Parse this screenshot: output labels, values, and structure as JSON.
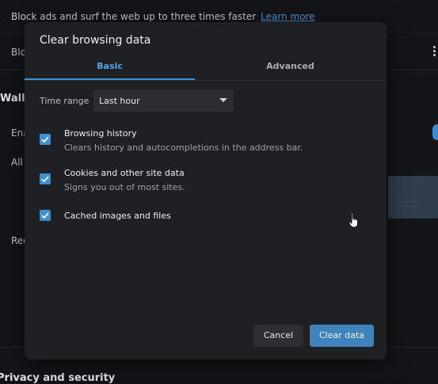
{
  "background": {
    "adblock_text": "Block ads and surf the web up to three times faster",
    "learn_more": "Learn more",
    "row2_prefix": "Blo",
    "section_prefix": "Wallp",
    "enable_prefix": "Ena",
    "all_prefix": "All",
    "rec_prefix": "Rec",
    "privacy_heading": "Privacy and security"
  },
  "dialog": {
    "title": "Clear browsing data",
    "tabs": [
      {
        "label": "Basic",
        "selected": true
      },
      {
        "label": "Advanced",
        "selected": false
      }
    ],
    "time_range": {
      "label": "Time range",
      "value": "Last hour"
    },
    "options": [
      {
        "title": "Browsing history",
        "description": "Clears history and autocompletions in the address bar.",
        "checked": true
      },
      {
        "title": "Cookies and other site data",
        "description": "Signs you out of most sites.",
        "checked": true
      },
      {
        "title": "Cached images and files",
        "description": "",
        "checked": true
      }
    ],
    "buttons": {
      "cancel": "Cancel",
      "clear": "Clear data"
    }
  },
  "colors": {
    "accent": "#3d8fd4",
    "dialog_bg": "#1e2024",
    "page_bg": "#141518"
  }
}
